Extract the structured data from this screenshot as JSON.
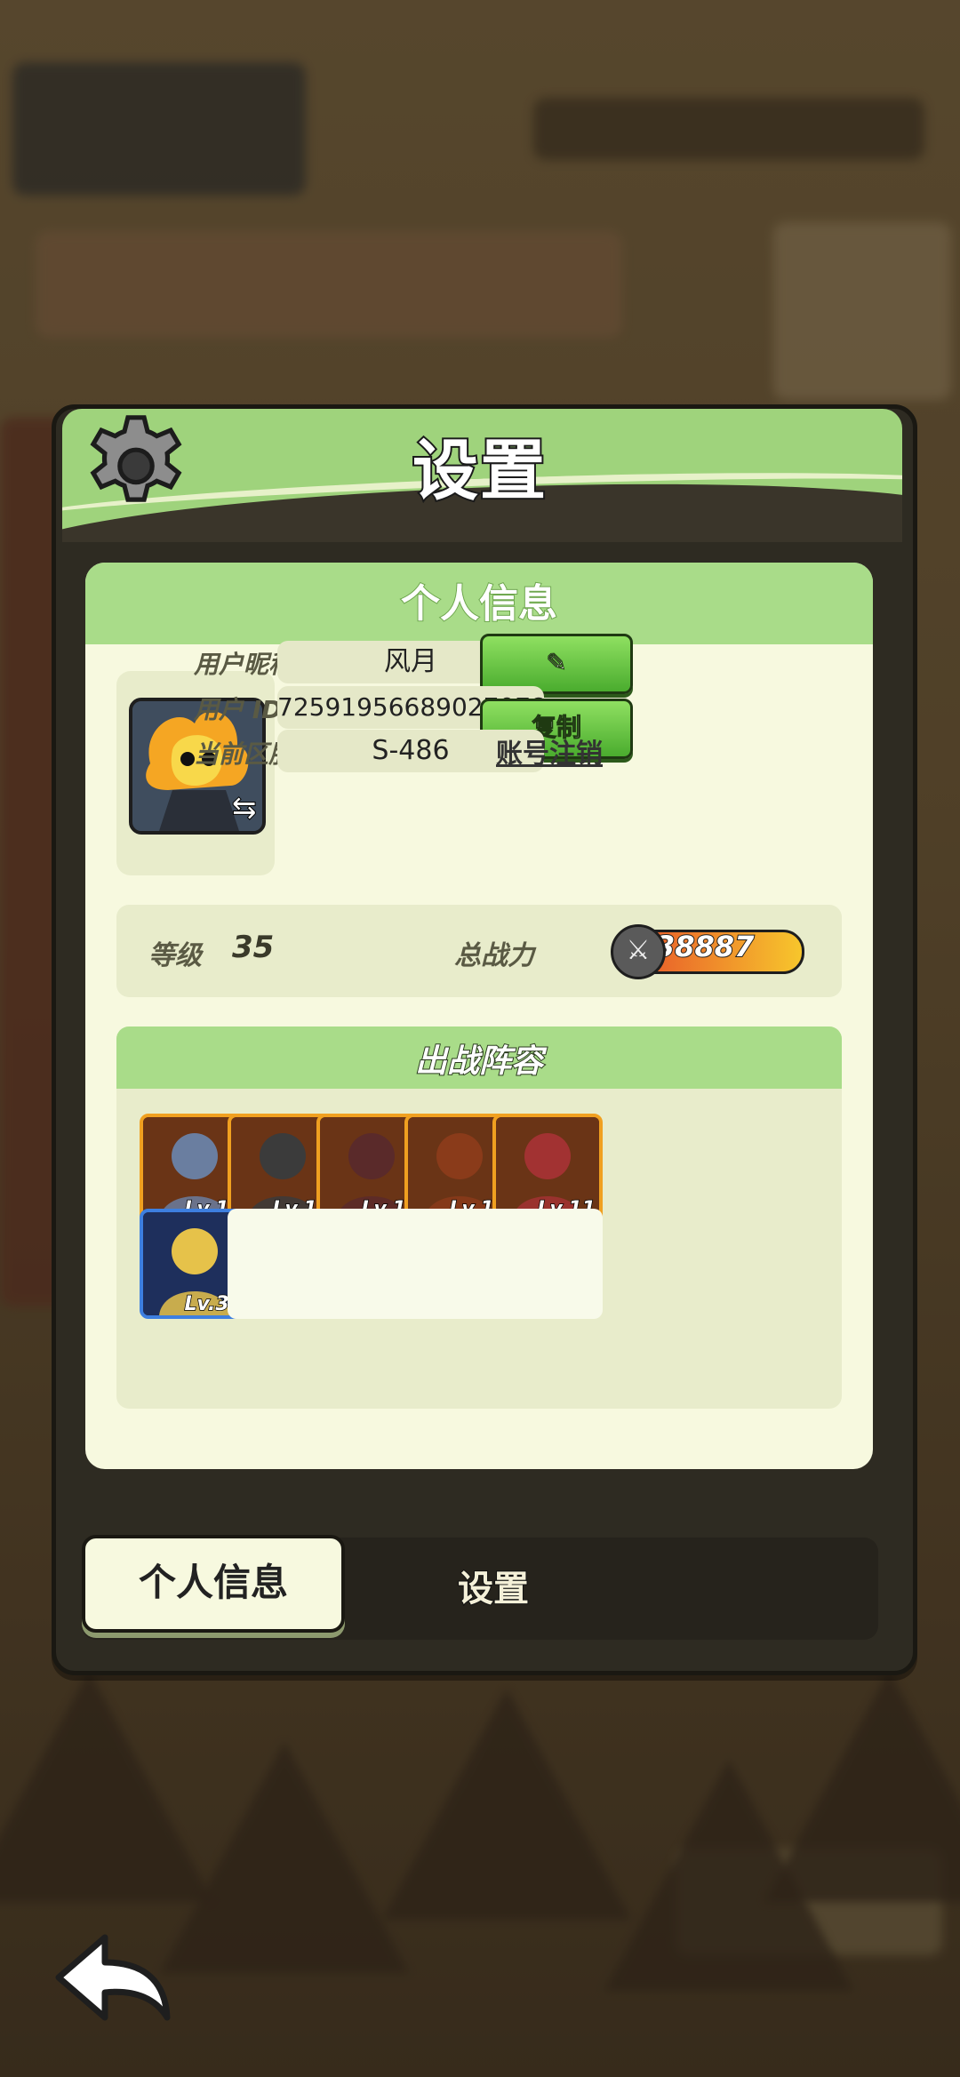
{
  "window": {
    "title": "设置"
  },
  "info_card": {
    "title": "个人信息",
    "nickname_label": "用户昵称",
    "nickname_value": "风月",
    "userid_label": "用户 ID",
    "userid_value": "72591956689027078",
    "server_label": "当前区服",
    "server_value": "S-486",
    "copy_button": "复制",
    "account_cancel_link": "账号注销"
  },
  "stats": {
    "level_label": "等级",
    "level_value": "35",
    "power_label": "总战力",
    "power_value": "38887"
  },
  "team": {
    "title": "出战阵容",
    "heroes": [
      {
        "level": "Lv.10",
        "color": "#6a7ea0"
      },
      {
        "level": "Lv.14",
        "color": "#3b3b3b"
      },
      {
        "level": "Lv.14",
        "color": "#5a2a2a"
      },
      {
        "level": "Lv.10",
        "color": "#8a3b1a"
      },
      {
        "level": "Lv.11",
        "color": "#a23232"
      },
      {
        "level": "Lv.30",
        "color": "#e6c24a"
      }
    ]
  },
  "tabs": {
    "active": "个人信息",
    "other": "设置"
  },
  "colors": {
    "accent_green": "#a9dc89",
    "card_bg": "#f7f9df",
    "power_orange": "#e85a2a"
  }
}
